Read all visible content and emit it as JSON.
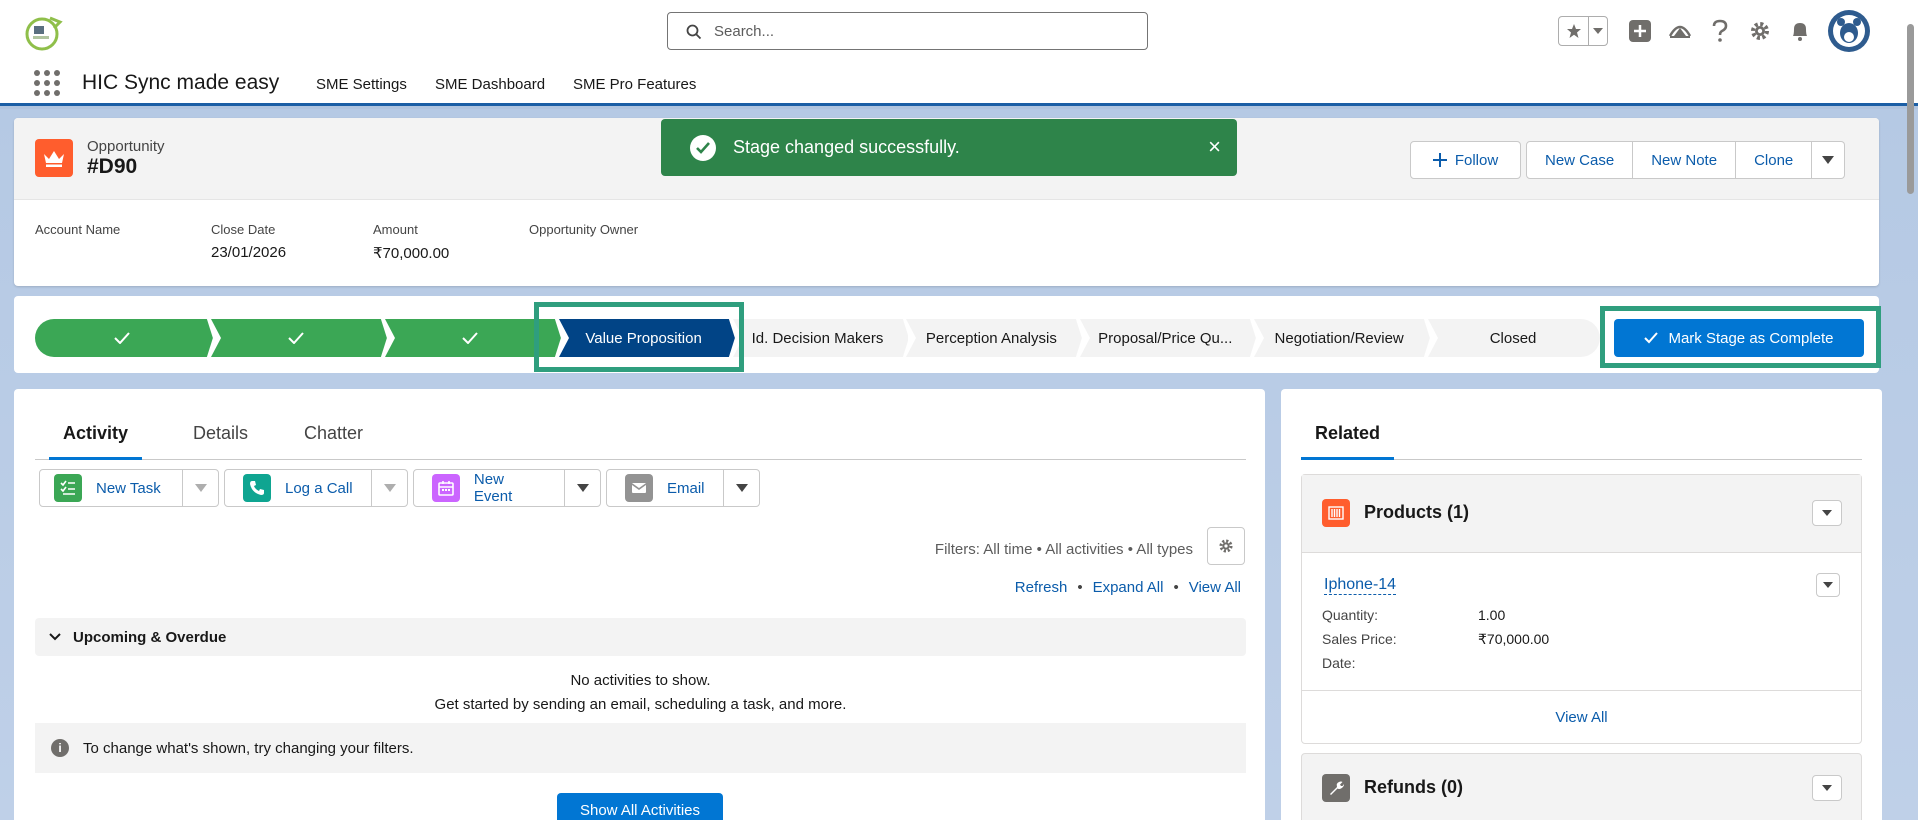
{
  "header": {
    "search_placeholder": "Search..."
  },
  "nav": {
    "app_name": "HIC Sync made easy",
    "items": [
      "SME Settings",
      "SME Dashboard",
      "SME Pro Features"
    ]
  },
  "record": {
    "object_label": "Opportunity",
    "title": "#D90",
    "buttons": {
      "follow": "Follow",
      "new_case": "New Case",
      "new_note": "New Note",
      "clone": "Clone"
    },
    "fields": [
      {
        "label": "Account Name",
        "value": ""
      },
      {
        "label": "Close Date",
        "value": "23/01/2026"
      },
      {
        "label": "Amount",
        "value": "₹70,000.00"
      },
      {
        "label": "Opportunity Owner",
        "value": ""
      }
    ]
  },
  "toast": {
    "message": "Stage changed successfully.",
    "close": "×",
    "color": "#2e844a"
  },
  "path": {
    "stages": [
      "",
      "",
      "",
      "Value Proposition",
      "Id. Decision Makers",
      "Perception Analysis",
      "Proposal/Price Qu...",
      "Negotiation/Review",
      "Closed"
    ],
    "completed_count": 3,
    "current_index": 3,
    "mark_button": "Mark Stage as Complete",
    "colors": {
      "done": "#3ba755",
      "current": "#014486",
      "pending": "#f3f3f3",
      "highlight": "#2f9e7e"
    }
  },
  "activity": {
    "tabs": [
      "Activity",
      "Details",
      "Chatter"
    ],
    "publishers": [
      "New Task",
      "Log a Call",
      "New Event",
      "Email"
    ],
    "filters_text": "Filters: All time • All activities • All types",
    "links": {
      "refresh": "Refresh",
      "expand": "Expand All",
      "view_all": "View All",
      "separator": "•"
    },
    "upcoming_title": "Upcoming & Overdue",
    "empty_title": "No activities to show.",
    "empty_sub": "Get started by sending an email, scheduling a task, and more.",
    "info_text": "To change what's shown, try changing your filters.",
    "show_all": "Show All Activities"
  },
  "related": {
    "tab": "Related",
    "products": {
      "title": "Products (1)",
      "item_name": "Iphone-14",
      "rows": [
        {
          "label": "Quantity:",
          "value": "1.00"
        },
        {
          "label": "Sales Price:",
          "value": "₹70,000.00"
        },
        {
          "label": "Date:",
          "value": ""
        }
      ],
      "view_all": "View All"
    },
    "refunds_title": "Refunds (0)"
  }
}
